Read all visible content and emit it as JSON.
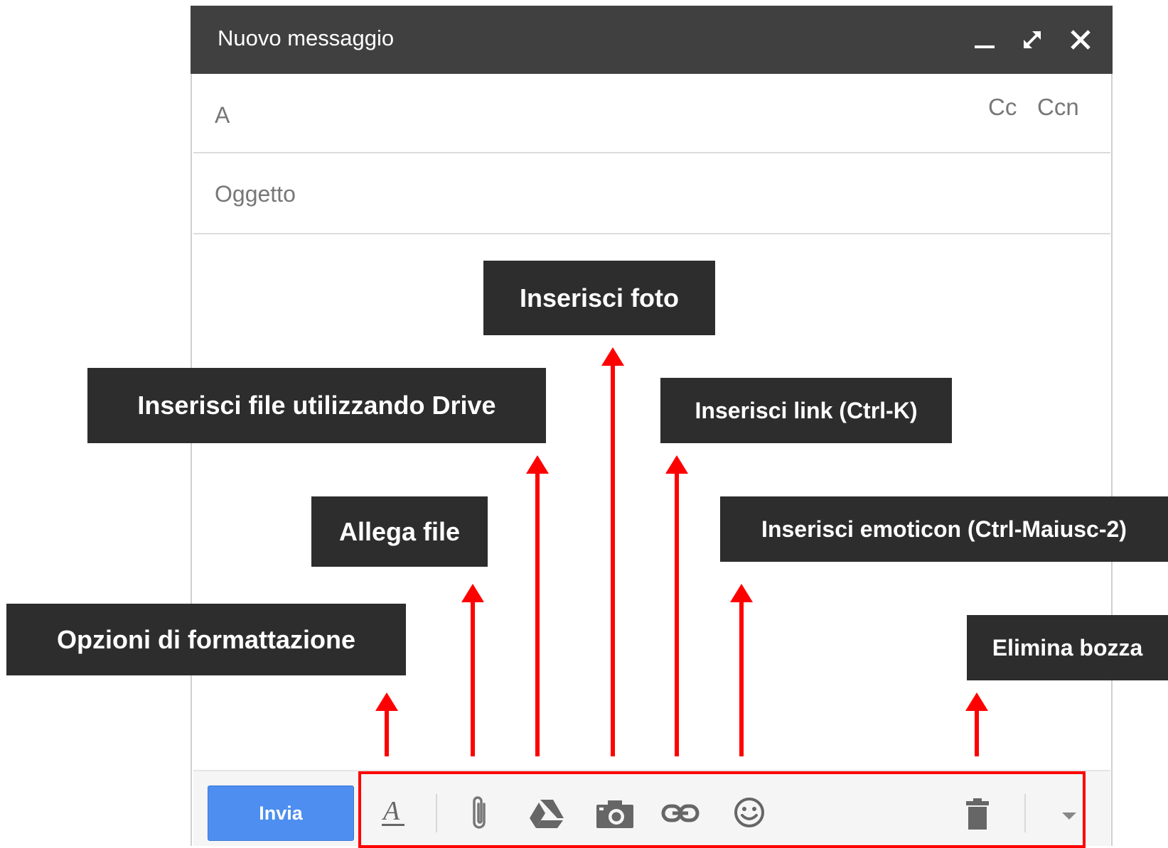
{
  "window": {
    "title": "Nuovo messaggio",
    "controls": [
      "minimize-icon",
      "fullscreen-icon",
      "close-icon"
    ]
  },
  "fields": {
    "to_label": "A",
    "cc_label": "Cc",
    "bcc_label": "Ccn",
    "subject_placeholder": "Oggetto"
  },
  "toolbar": {
    "send_label": "Invia",
    "icons": [
      "format-text-icon",
      "attach-icon",
      "drive-icon",
      "camera-icon",
      "link-icon",
      "emoji-icon",
      "trash-icon",
      "chevron-down-icon"
    ]
  },
  "annotations": {
    "formatting": "Opzioni di formattazione",
    "attach": "Allega file",
    "drive": "Inserisci file utilizzando Drive",
    "photo": "Inserisci foto",
    "link": "Inserisci link (Ctrl-K)",
    "emoticon": "Inserisci emoticon (Ctrl-Maiusc-2)",
    "delete": "Elimina bozza"
  },
  "colors": {
    "titlebar": "#404040",
    "send_button": "#4d8ef0",
    "annotation_bg": "#2d2d2d",
    "highlight": "#ff0000"
  }
}
